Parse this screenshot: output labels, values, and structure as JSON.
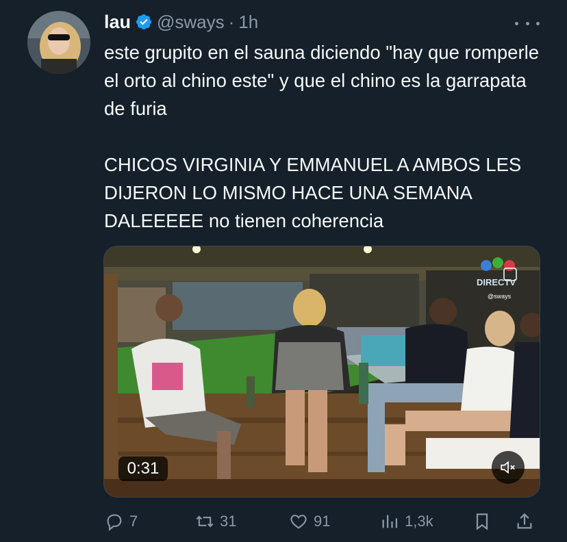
{
  "tweet": {
    "author_name": "lau",
    "handle": "@sways",
    "separator": "·",
    "time": "1h",
    "text": "este grupito en el sauna diciendo \"hay que romperle el orto al chino este\" y que el chino es la garrapata de furia\n\nCHICOS VIRGINIA Y EMMANUEL A AMBOS LES DIJERON LO MISMO HACE UNA SEMANA DALEEEEE no tienen coherencia",
    "verified": true
  },
  "video": {
    "duration": "0:31",
    "watermark_text": "@sways",
    "channel_logo": "DIRECTV"
  },
  "metrics": {
    "replies": "7",
    "reposts": "31",
    "likes": "91",
    "views": "1,3k"
  },
  "icons": {
    "reply": "reply-icon",
    "repost": "repost-icon",
    "like": "heart-icon",
    "views": "views-icon",
    "bookmark": "bookmark-icon",
    "share": "share-icon",
    "mute": "mute-icon",
    "verified": "verified-badge-icon",
    "more": "more-icon"
  },
  "colors": {
    "background": "#15202b",
    "text": "#f7f9f9",
    "secondary": "#8b98a5",
    "verified": "#1d9bf0"
  }
}
